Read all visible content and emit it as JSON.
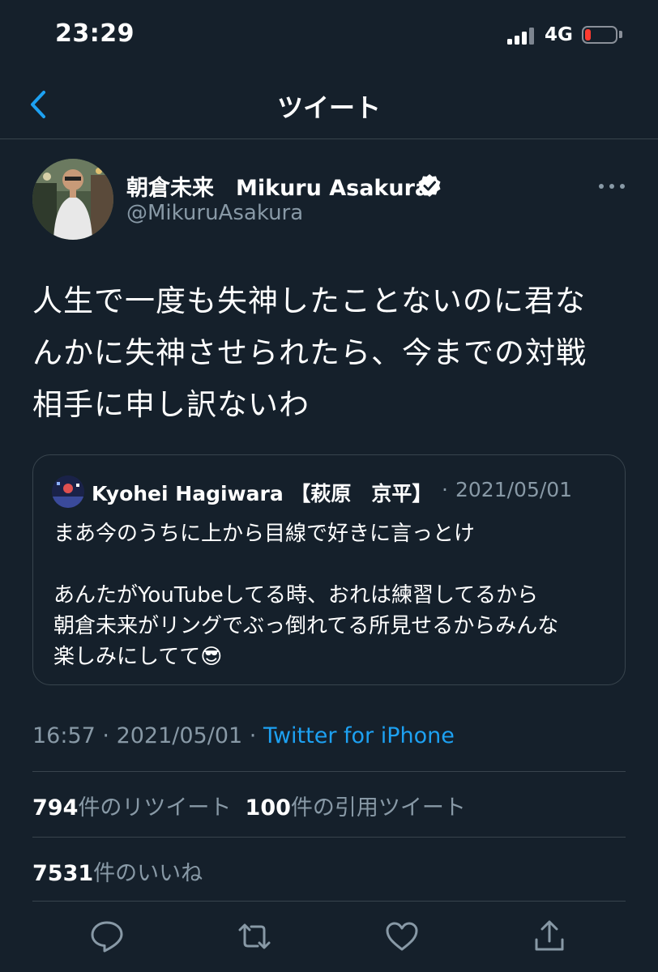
{
  "status_bar": {
    "time": "23:29",
    "network": "4G",
    "battery_level": 0.2
  },
  "nav": {
    "title": "ツイート",
    "back_icon": "chevron-left-icon"
  },
  "tweet": {
    "author_name": "朝倉未来　Mikuru Asakura",
    "handle": "@MikuruAsakura",
    "verified": true,
    "text_lines": [
      "人生で一度も失神したことないのに君な",
      "んかに失神させられたら、今までの対戦",
      "相手に申し訳ないわ"
    ],
    "time": "16:57",
    "date": "2021/05/01",
    "source": "Twitter for iPhone",
    "retweets": "794",
    "retweets_label": "件のリツイート",
    "quotes": "100",
    "quotes_label": "件の引用ツイート",
    "likes": "7531",
    "likes_label": "件のいいね"
  },
  "quoted_tweet": {
    "author_name": "Kyohei Hagiwara 【萩原　京平】",
    "date": "2021/05/01",
    "text": "まあ今のうちに上から目線で好きに言っとけ\n\nあんたがYouTubeしてる時、おれは練習してるから\n朝倉未来がリングでぶっ倒れてる所見せるからみんな\n楽しみにしてて😎"
  },
  "colors": {
    "background": "#15202b",
    "text": "#ffffff",
    "muted": "#8899a6",
    "accent": "#1da1f2",
    "border": "#38444d"
  }
}
